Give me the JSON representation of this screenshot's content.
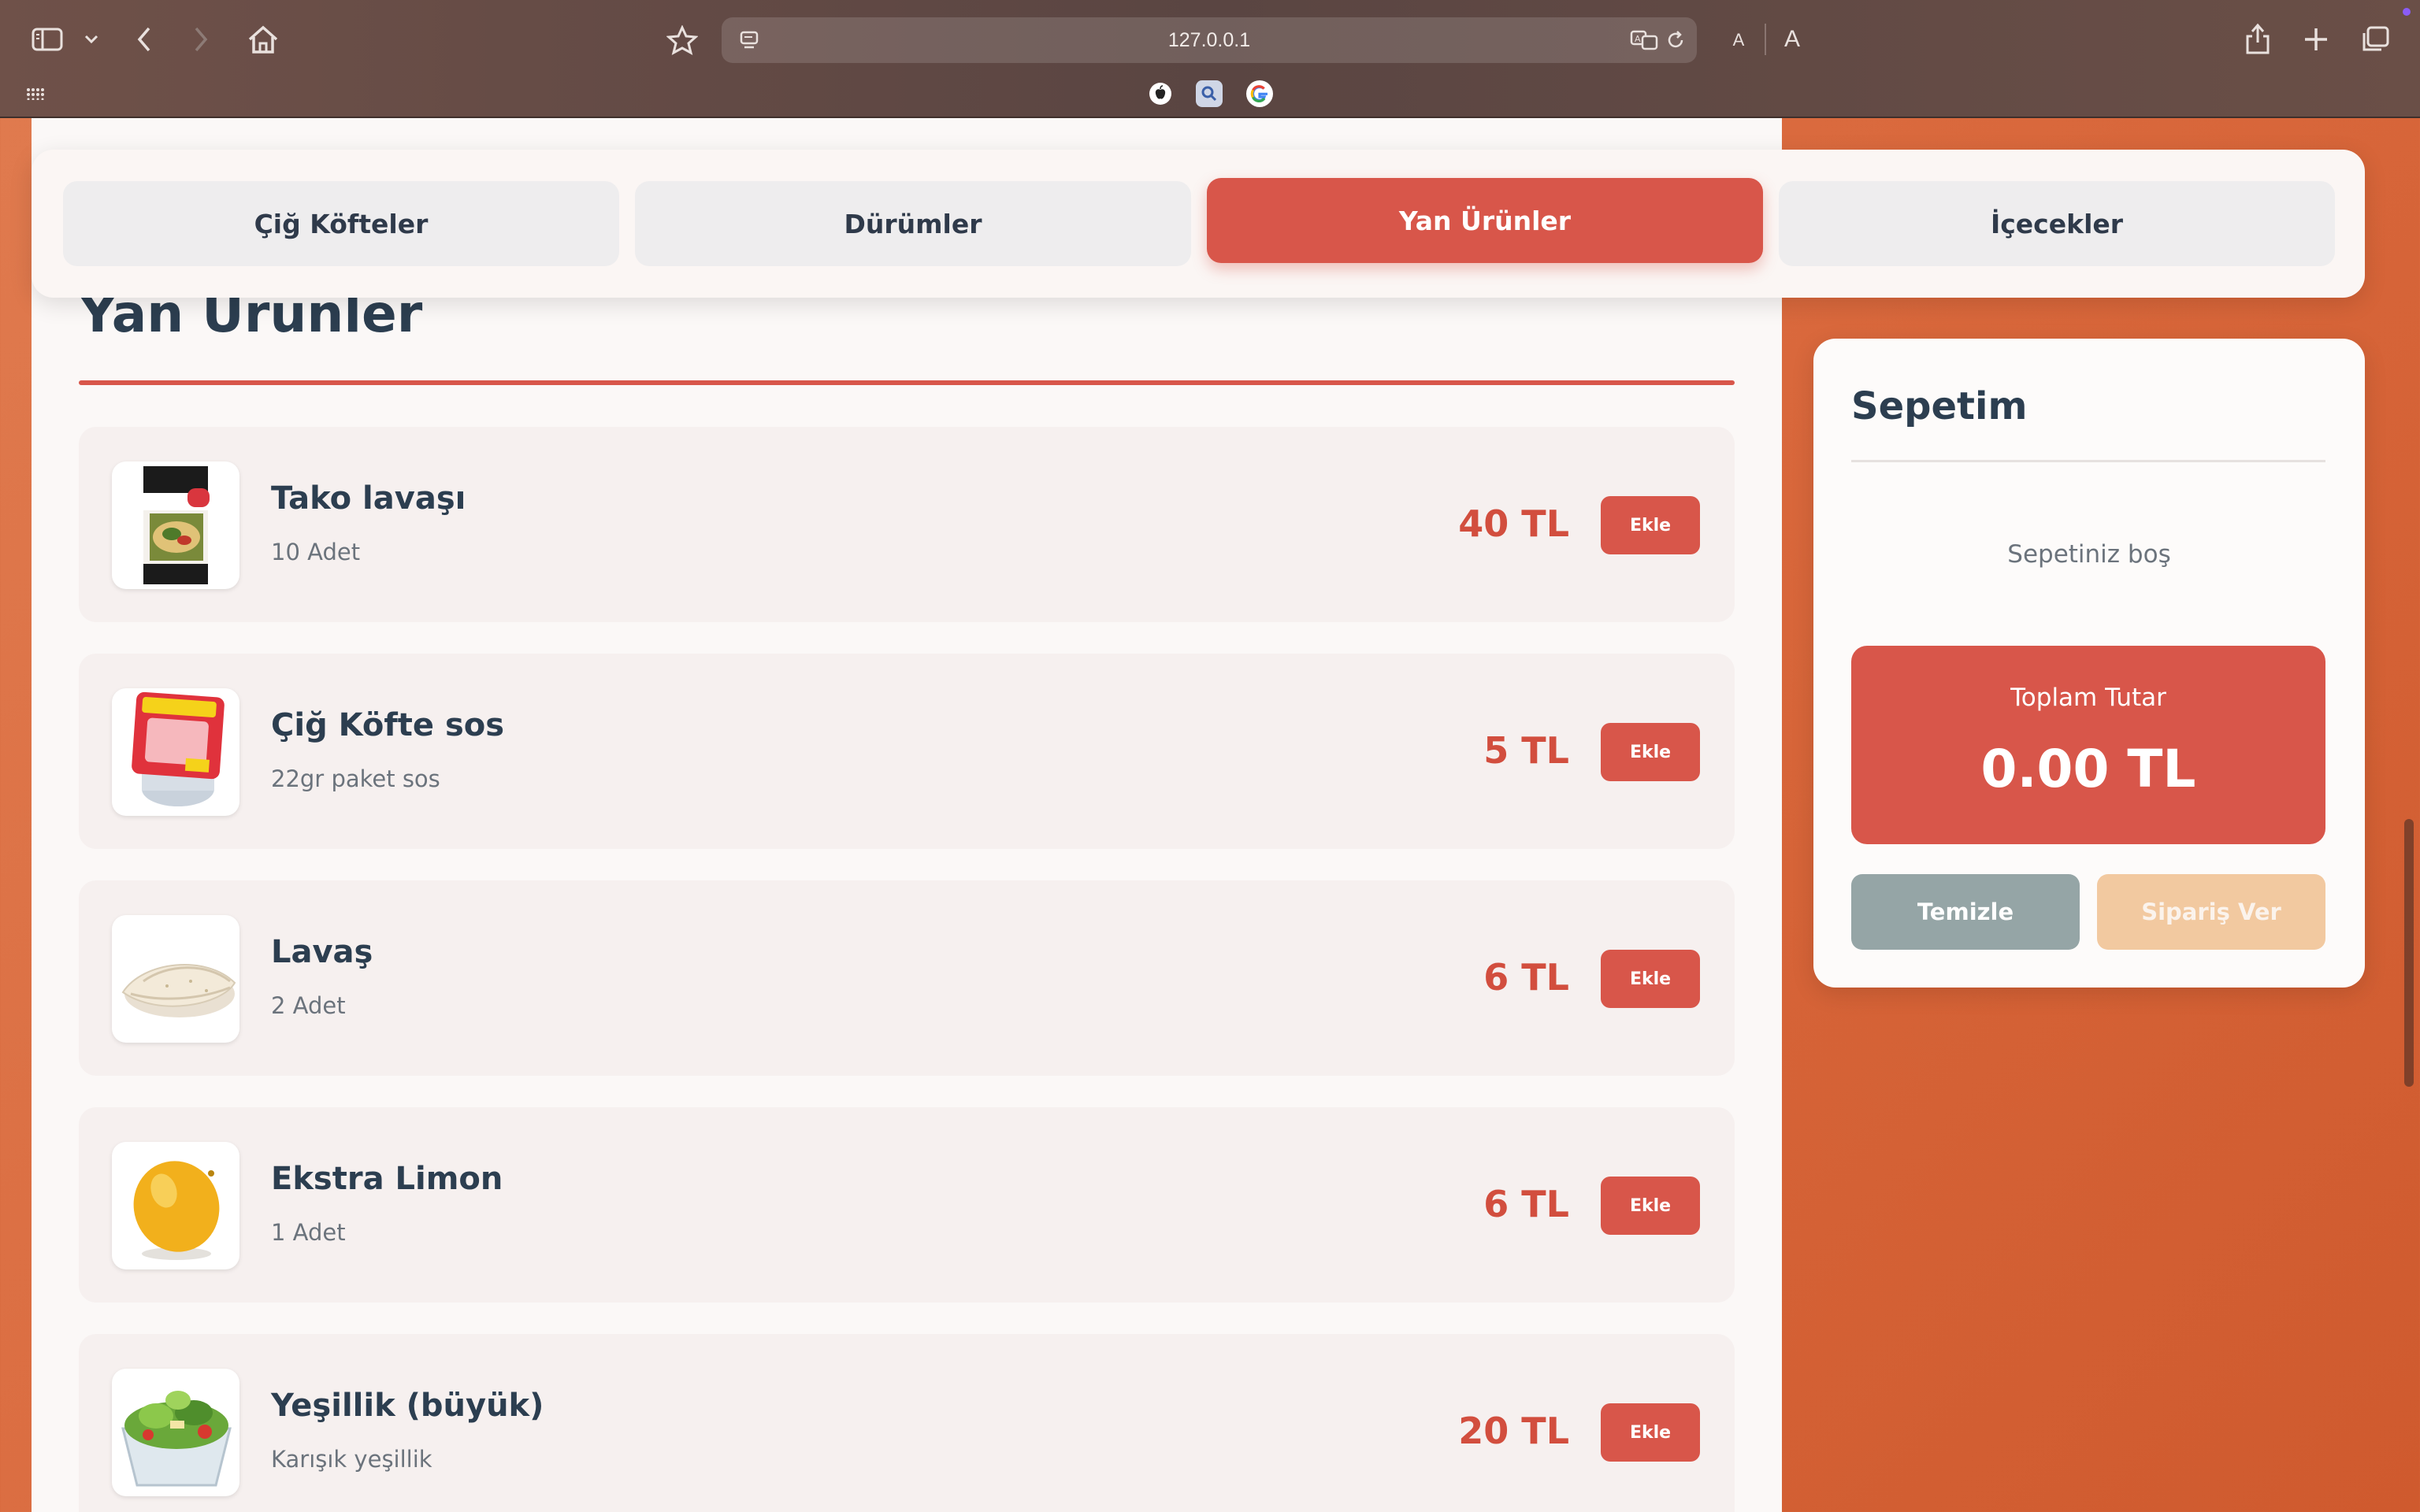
{
  "browser": {
    "url": "127.0.0.1",
    "reader_small_a": "A",
    "reader_large_a": "A"
  },
  "tabs": [
    {
      "label": "Çiğ Köfteler",
      "active": false
    },
    {
      "label": "Dürümler",
      "active": false
    },
    {
      "label": "Yan Ürünler",
      "active": true
    },
    {
      "label": "İçecekler",
      "active": false
    }
  ],
  "section": {
    "title": "Yan Ürünler"
  },
  "products": [
    {
      "name": "Tako lavaşı",
      "desc": "10 Adet",
      "price": "40 TL",
      "button": "Ekle",
      "image": "tortilla-pack-image"
    },
    {
      "name": "Çiğ Köfte sos",
      "desc": "22gr paket sos",
      "price": "5 TL",
      "button": "Ekle",
      "image": "sauce-packet-image"
    },
    {
      "name": "Lavaş",
      "desc": "2 Adet",
      "price": "6 TL",
      "button": "Ekle",
      "image": "flatbread-image"
    },
    {
      "name": "Ekstra Limon",
      "desc": "1 Adet",
      "price": "6 TL",
      "button": "Ekle",
      "image": "lemon-image"
    },
    {
      "name": "Yeşillik (büyük)",
      "desc": "Karışık yeşillik",
      "price": "20 TL",
      "button": "Ekle",
      "image": "greens-bowl-image"
    }
  ],
  "cart": {
    "title": "Sepetim",
    "empty_text": "Sepetiniz boş",
    "total_label": "Toplam Tutar",
    "total_amount": "0.00 TL",
    "clear_button": "Temizle",
    "order_button": "Sipariş Ver"
  },
  "colors": {
    "accent": "#d8564a",
    "heading": "#2c3e50",
    "clear_button": "#95a5a6",
    "order_button_disabled": "#f2c9a0"
  }
}
